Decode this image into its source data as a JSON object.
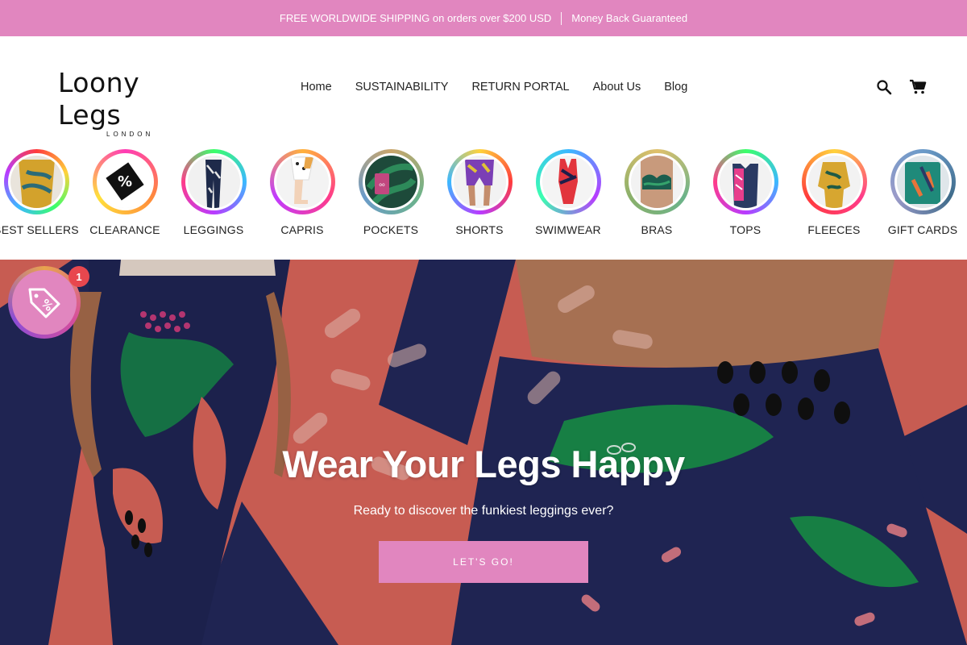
{
  "announcement": {
    "shipping": "FREE WORLDWIDE SHIPPING on orders over $200 USD",
    "guarantee": "Money Back Guaranteed"
  },
  "brand": {
    "name": "Loony Legs",
    "sub": "LONDON"
  },
  "nav": [
    "Home",
    "SUSTAINABILITY",
    "RETURN PORTAL",
    "About Us",
    "Blog"
  ],
  "header_icons": [
    "search-icon",
    "cart-icon"
  ],
  "categories": [
    {
      "label": "BEST SELLERS"
    },
    {
      "label": "CLEARANCE"
    },
    {
      "label": "LEGGINGS"
    },
    {
      "label": "CAPRIS"
    },
    {
      "label": "POCKETS"
    },
    {
      "label": "SHORTS"
    },
    {
      "label": "SWIMWEAR"
    },
    {
      "label": "BRAS"
    },
    {
      "label": "TOPS"
    },
    {
      "label": "FLEECES"
    },
    {
      "label": "GIFT CARDS"
    }
  ],
  "hero": {
    "title": "Wear Your Legs Happy",
    "subtitle": "Ready to discover the funkiest leggings ever?",
    "button": "LET'S GO!"
  },
  "promo": {
    "badge_count": "1",
    "icon": "discount-tag-icon"
  },
  "colors": {
    "accent": "#e186bf",
    "hero_bg": "#d8645a",
    "navy": "#22285a",
    "badge": "#e8474e"
  }
}
